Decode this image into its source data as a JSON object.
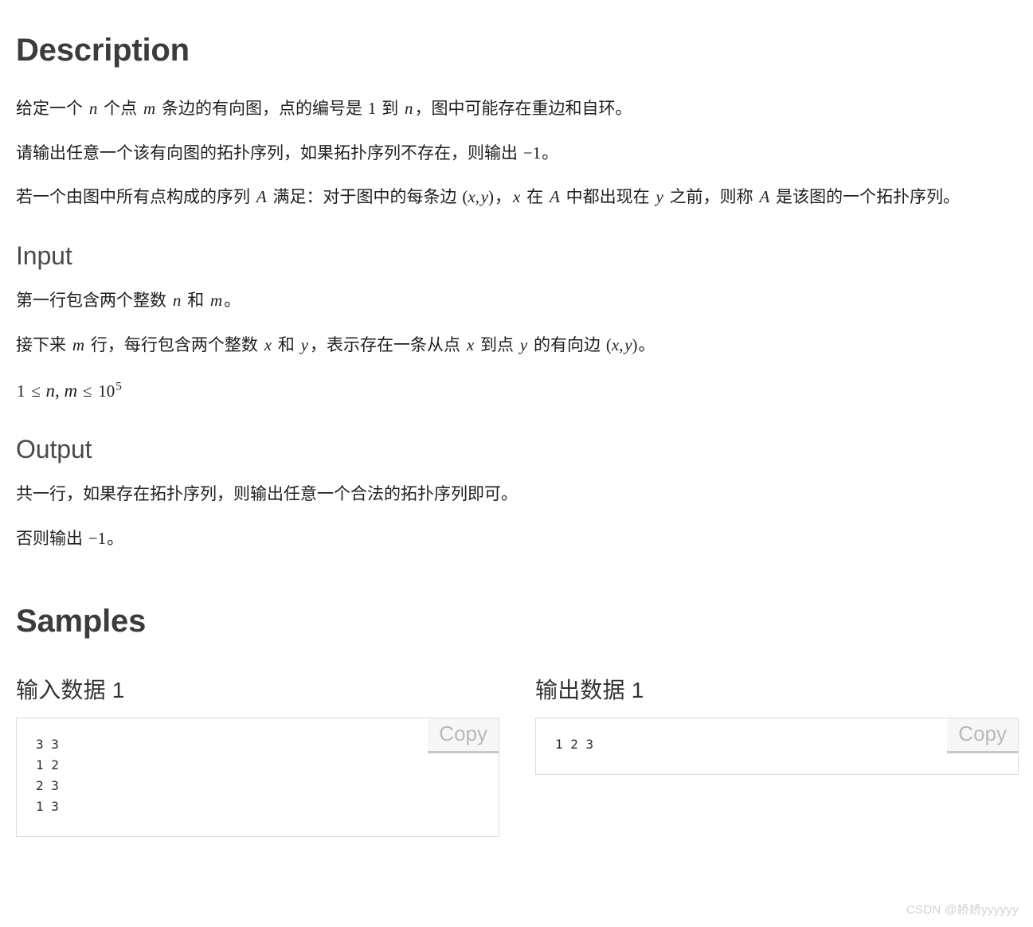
{
  "sections": {
    "description": {
      "heading": "Description",
      "paragraphs": [
        {
          "id": "p1",
          "parts": [
            {
              "t": "text",
              "v": "给定一个 "
            },
            {
              "t": "math",
              "v": "n"
            },
            {
              "t": "text",
              "v": " 个点 "
            },
            {
              "t": "math",
              "v": "m"
            },
            {
              "t": "text",
              "v": " 条边的有向图，点的编号是 "
            },
            {
              "t": "num",
              "v": "1"
            },
            {
              "t": "text",
              "v": " 到 "
            },
            {
              "t": "math",
              "v": "n"
            },
            {
              "t": "text",
              "v": "，图中可能存在重边和自环。"
            }
          ],
          "plain": "给定一个 n 个点 m 条边的有向图，点的编号是 1 到 n，图中可能存在重边和自环。"
        },
        {
          "id": "p2",
          "parts": [
            {
              "t": "text",
              "v": "请输出任意一个该有向图的拓扑序列，如果拓扑序列不存在，则输出 "
            },
            {
              "t": "num",
              "v": "−1"
            },
            {
              "t": "text",
              "v": "。"
            }
          ],
          "plain": "请输出任意一个该有向图的拓扑序列，如果拓扑序列不存在，则输出 −1。"
        },
        {
          "id": "p3",
          "parts": [
            {
              "t": "text",
              "v": "若一个由图中所有点构成的序列 "
            },
            {
              "t": "math",
              "v": "A"
            },
            {
              "t": "text",
              "v": " 满足：对于图中的每条边 "
            },
            {
              "t": "num",
              "v": "("
            },
            {
              "t": "math",
              "v": "x"
            },
            {
              "t": "num",
              "v": ", "
            },
            {
              "t": "math",
              "v": "y"
            },
            {
              "t": "num",
              "v": ")"
            },
            {
              "t": "text",
              "v": "，"
            },
            {
              "t": "math",
              "v": "x"
            },
            {
              "t": "text",
              "v": " 在 "
            },
            {
              "t": "math",
              "v": "A"
            },
            {
              "t": "text",
              "v": " 中都出现在 "
            },
            {
              "t": "math",
              "v": "y"
            },
            {
              "t": "text",
              "v": " 之前，则称 "
            },
            {
              "t": "math",
              "v": "A"
            },
            {
              "t": "text",
              "v": " 是该图的一个拓扑序列。"
            }
          ],
          "plain": "若一个由图中所有点构成的序列 A 满足：对于图中的每条边 (x,y)，x 在 A 中都出现在 y 之前，则称 A 是该图的一个拓扑序列。"
        }
      ]
    },
    "input": {
      "heading": "Input",
      "paragraphs": [
        {
          "id": "i1",
          "parts": [
            {
              "t": "text",
              "v": "第一行包含两个整数 "
            },
            {
              "t": "math",
              "v": "n"
            },
            {
              "t": "text",
              "v": " 和 "
            },
            {
              "t": "math",
              "v": "m"
            },
            {
              "t": "text",
              "v": "。"
            }
          ],
          "plain": "第一行包含两个整数 n 和 m。"
        },
        {
          "id": "i2",
          "parts": [
            {
              "t": "text",
              "v": "接下来 "
            },
            {
              "t": "math",
              "v": "m"
            },
            {
              "t": "text",
              "v": " 行，每行包含两个整数 "
            },
            {
              "t": "math",
              "v": "x"
            },
            {
              "t": "text",
              "v": " 和 "
            },
            {
              "t": "math",
              "v": "y"
            },
            {
              "t": "text",
              "v": "，表示存在一条从点 "
            },
            {
              "t": "math",
              "v": "x"
            },
            {
              "t": "text",
              "v": " 到点 "
            },
            {
              "t": "math",
              "v": "y"
            },
            {
              "t": "text",
              "v": " 的有向边 "
            },
            {
              "t": "num",
              "v": "("
            },
            {
              "t": "math",
              "v": "x"
            },
            {
              "t": "num",
              "v": ", "
            },
            {
              "t": "math",
              "v": "y"
            },
            {
              "t": "num",
              "v": ")"
            },
            {
              "t": "text",
              "v": "。"
            }
          ],
          "plain": "接下来 m 行，每行包含两个整数 x 和 y，表示存在一条从点 x 到点 y 的有向边 (x,y)。"
        }
      ],
      "constraint": "1 ≤ n, m ≤ 10^5",
      "constraint_parts": {
        "lower": "1",
        "rel1": "≤",
        "vars": "n, m",
        "rel2": "≤",
        "base": "10",
        "exponent": "5"
      }
    },
    "output": {
      "heading": "Output",
      "paragraphs": [
        {
          "id": "o1",
          "parts": [
            {
              "t": "text",
              "v": "共一行，如果存在拓扑序列，则输出任意一个合法的拓扑序列即可。"
            }
          ],
          "plain": "共一行，如果存在拓扑序列，则输出任意一个合法的拓扑序列即可。"
        },
        {
          "id": "o2",
          "parts": [
            {
              "t": "text",
              "v": "否则输出 "
            },
            {
              "t": "num",
              "v": "−1"
            },
            {
              "t": "text",
              "v": "。"
            }
          ],
          "plain": "否则输出 −1。"
        }
      ]
    },
    "samples": {
      "heading": "Samples",
      "copy_label": "Copy",
      "items": [
        {
          "label": "输入数据 1",
          "code": "3 3\n1 2\n2 3\n1 3"
        },
        {
          "label": "输出数据 1",
          "code": "1 2 3"
        }
      ]
    }
  },
  "watermark": "CSDN @娇娇yyyyyy",
  "colors": {
    "heading": "#3c3c3c",
    "subheading": "#4a4a4a",
    "body_text": "#1f1f1f",
    "box_border": "#dcdcdc",
    "copy_bg": "#f7f7f7",
    "copy_text": "#b9b9b9",
    "watermark": "#d2d2d2",
    "page_bg": "#ffffff"
  }
}
